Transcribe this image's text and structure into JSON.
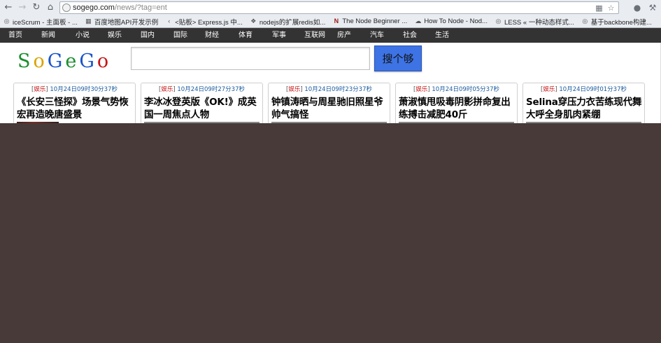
{
  "browser": {
    "url_host": "sogego.com",
    "url_path": "/news/?tag=ent",
    "bookmarks": [
      {
        "label": "iceScrum - 主面板 - ...",
        "icon": "globe-icon"
      },
      {
        "label": "百度地图API开发示例",
        "icon": "map-icon"
      },
      {
        "label": "<贴板> Express.js 中...",
        "icon": "script-icon"
      },
      {
        "label": "nodejs的扩展redis如...",
        "icon": "puzzle-icon"
      },
      {
        "label": "The Node Beginner ...",
        "icon": "n-logo-icon"
      },
      {
        "label": "How To Node - Nod...",
        "icon": "cloud-icon"
      },
      {
        "label": "LESS « 一种动态样式...",
        "icon": "globe-icon"
      },
      {
        "label": "基于backbone构建...",
        "icon": "globe-icon"
      }
    ]
  },
  "nav": {
    "items": [
      "首页",
      "新闻",
      "小说",
      "娱乐",
      "国内",
      "国际",
      "财经",
      "体育",
      "军事",
      "互联网",
      "房产",
      "汽车",
      "社会",
      "生活"
    ]
  },
  "logo": {
    "letters": [
      {
        "ch": "S",
        "color": "#1a8f2e"
      },
      {
        "ch": "o",
        "color": "#d9a400"
      },
      {
        "ch": "G",
        "color": "#1a55c8"
      },
      {
        "ch": "e",
        "color": "#1a8f2e"
      },
      {
        "ch": "G",
        "color": "#1a55c8"
      },
      {
        "ch": "o",
        "color": "#c81414"
      }
    ]
  },
  "search": {
    "value": "",
    "button_label": "搜个够"
  },
  "cards": [
    {
      "tag": "娱乐",
      "time": "10月24日09时30分37秒",
      "title": "《长安三怪探》场景气势恢宏再造晚唐盛景"
    },
    {
      "tag": "娱乐",
      "time": "10月24日09时27分37秒",
      "title": "李冰冰登英版《OK!》成英国一周焦点人物"
    },
    {
      "tag": "娱乐",
      "time": "10月24日09时23分37秒",
      "title": "钟镇涛晒与周星驰旧照星爷帅气搞怪"
    },
    {
      "tag": "娱乐",
      "time": "10月24日09时05分37秒",
      "title": "萧淑慎甩吸毒阴影拼命复出练搏击减肥40斤"
    },
    {
      "tag": "娱乐",
      "time": "10月24日09时01分37秒",
      "title": "Selina穿压力衣苦练现代舞大呼全身肌肉紧绷"
    }
  ],
  "colors": {
    "nav_bg": "#333333",
    "search_btn": "#3d73e4",
    "tag": "#c81414",
    "time": "#1a5a9e",
    "backdrop": "#473a39"
  }
}
